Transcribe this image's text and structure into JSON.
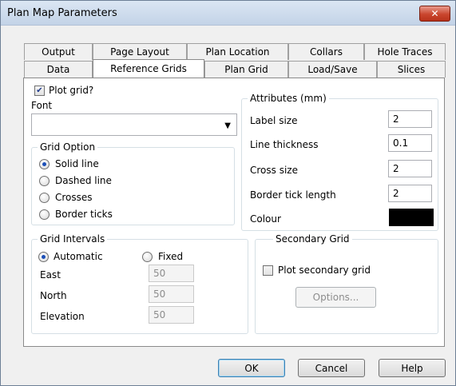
{
  "window": {
    "title": "Plan Map Parameters",
    "close_label": "✕"
  },
  "tabs": {
    "back": [
      "Output",
      "Page Layout",
      "Plan Location",
      "Collars",
      "Hole Traces"
    ],
    "front": [
      "Data",
      "Reference Grids",
      "Plan Grid",
      "Load/Save",
      "Slices"
    ],
    "active": "Reference Grids"
  },
  "plot_grid": {
    "label": "Plot grid?",
    "checked": true,
    "check_glyph": "✔"
  },
  "font": {
    "label": "Font",
    "value": "",
    "arrow": "▼"
  },
  "grid_option": {
    "title": "Grid Option",
    "options": [
      "Solid line",
      "Dashed line",
      "Crosses",
      "Border ticks"
    ],
    "selected": "Solid line"
  },
  "attributes": {
    "title": "Attributes (mm)",
    "label_size": {
      "label": "Label size",
      "value": "2"
    },
    "line_thickness": {
      "label": "Line thickness",
      "value": "0.1"
    },
    "cross_size": {
      "label": "Cross size",
      "value": "2"
    },
    "border_tick_length": {
      "label": "Border tick length",
      "value": "2"
    },
    "colour": {
      "label": "Colour",
      "value": "#000000"
    }
  },
  "grid_intervals": {
    "title": "Grid Intervals",
    "automatic_label": "Automatic",
    "fixed_label": "Fixed",
    "mode": "Automatic",
    "east": {
      "label": "East",
      "value": "50"
    },
    "north": {
      "label": "North",
      "value": "50"
    },
    "elevation": {
      "label": "Elevation",
      "value": "50"
    }
  },
  "secondary_grid": {
    "title": "Secondary Grid",
    "plot_label": "Plot secondary grid",
    "checked": false,
    "options_label": "Options..."
  },
  "buttons": {
    "ok": "OK",
    "cancel": "Cancel",
    "help": "Help"
  }
}
